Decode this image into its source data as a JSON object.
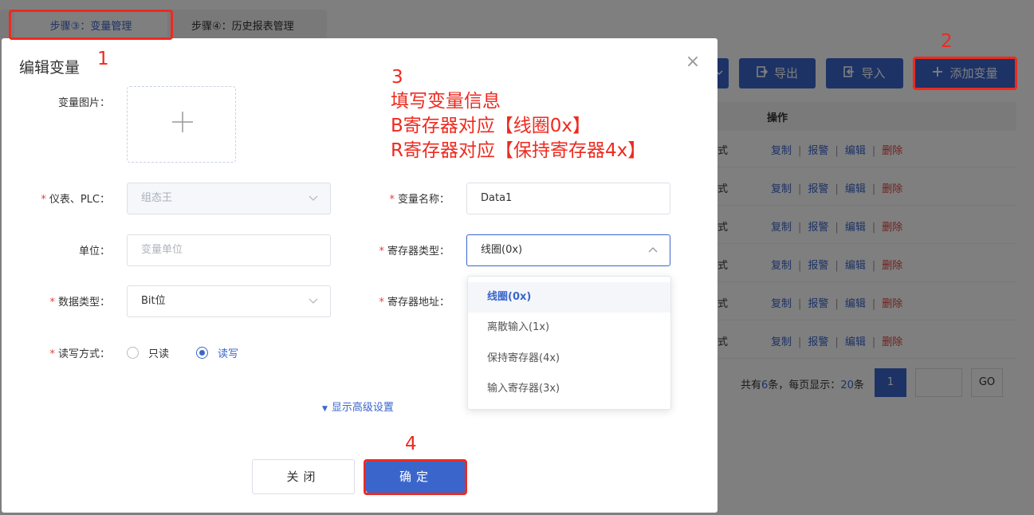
{
  "background": {
    "tabs": [
      "步骤③：变量管理",
      "步骤④：历史报表管理"
    ],
    "toolbar": {
      "export_label": "导出",
      "import_label": "导入",
      "add_label": "添加变量"
    },
    "table": {
      "ops_header": "操作",
      "rows": [
        {
          "mode": "式",
          "copy": "复制",
          "alarm": "报警",
          "edit": "编辑",
          "delete": "删除"
        },
        {
          "mode": "式",
          "copy": "复制",
          "alarm": "报警",
          "edit": "编辑",
          "delete": "删除"
        },
        {
          "mode": "式",
          "copy": "复制",
          "alarm": "报警",
          "edit": "编辑",
          "delete": "删除"
        },
        {
          "mode": "式",
          "copy": "复制",
          "alarm": "报警",
          "edit": "编辑",
          "delete": "删除"
        },
        {
          "mode": "式",
          "copy": "复制",
          "alarm": "报警",
          "edit": "编辑",
          "delete": "删除"
        },
        {
          "mode": "式",
          "copy": "复制",
          "alarm": "报警",
          "edit": "编辑",
          "delete": "删除"
        }
      ]
    },
    "pager": {
      "prefix": "共有",
      "total": "6",
      "mid": "条，每页显示：",
      "per_page": "20",
      "suffix": "条",
      "current_page": "1",
      "go_label": "GO"
    }
  },
  "dialog": {
    "title": "编辑变量",
    "close_symbol": "×",
    "fields": {
      "image_label": "变量图片：",
      "device_label": "仪表、PLC：",
      "device_value": "组态王",
      "var_name_label": "变量名称：",
      "var_name_value": "Data1",
      "unit_label": "单位：",
      "unit_placeholder": "变量单位",
      "reg_type_label": "寄存器类型：",
      "reg_type_value": "线圈(0x)",
      "data_type_label": "数据类型：",
      "data_type_value": "Bit位",
      "reg_addr_label": "寄存器地址：",
      "rw_label": "读写方式：",
      "rw_options": [
        "只读",
        "读写"
      ],
      "rw_selected": "读写"
    },
    "register_options": [
      "线圈(0x)",
      "离散输入(1x)",
      "保持寄存器(4x)",
      "输入寄存器(3x)"
    ],
    "register_selected": "线圈(0x)",
    "advanced_label": "显示高级设置",
    "close_button": "关闭",
    "ok_button": "确定"
  },
  "annotations": {
    "numbers": [
      "1",
      "2",
      "3",
      "4"
    ],
    "lines": [
      "填写变量信息",
      "B寄存器对应【线圈0x】",
      "R寄存器对应【保持寄存器4x】"
    ],
    "color": "#ee2a1f"
  },
  "colors": {
    "primary": "#3a66cc",
    "danger": "#e0443f",
    "annotation": "#ee2a1f"
  }
}
